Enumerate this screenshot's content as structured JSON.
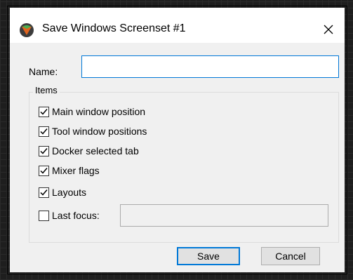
{
  "window": {
    "title": "Save Windows Screenset #1",
    "close_glyph": "✕"
  },
  "form": {
    "name_label": "Name:",
    "name_value": "",
    "items_group_label": "Items"
  },
  "items": [
    {
      "label": "Main window position",
      "checked": true
    },
    {
      "label": "Tool window positions",
      "checked": true
    },
    {
      "label": "Docker selected tab",
      "checked": true
    },
    {
      "label": "Mixer flags",
      "checked": true
    },
    {
      "label": "Layouts",
      "checked": true
    },
    {
      "label": "Last focus:",
      "checked": false
    }
  ],
  "last_focus_value": "",
  "buttons": {
    "save_label": "Save",
    "cancel_label": "Cancel"
  },
  "icons": {
    "app": "reaper-app-icon",
    "close": "close-icon",
    "check": "checkmark-icon"
  },
  "colors": {
    "accent": "#0078d7",
    "dialog_bg": "#f0f0f0",
    "titlebar_bg": "#ffffff"
  }
}
